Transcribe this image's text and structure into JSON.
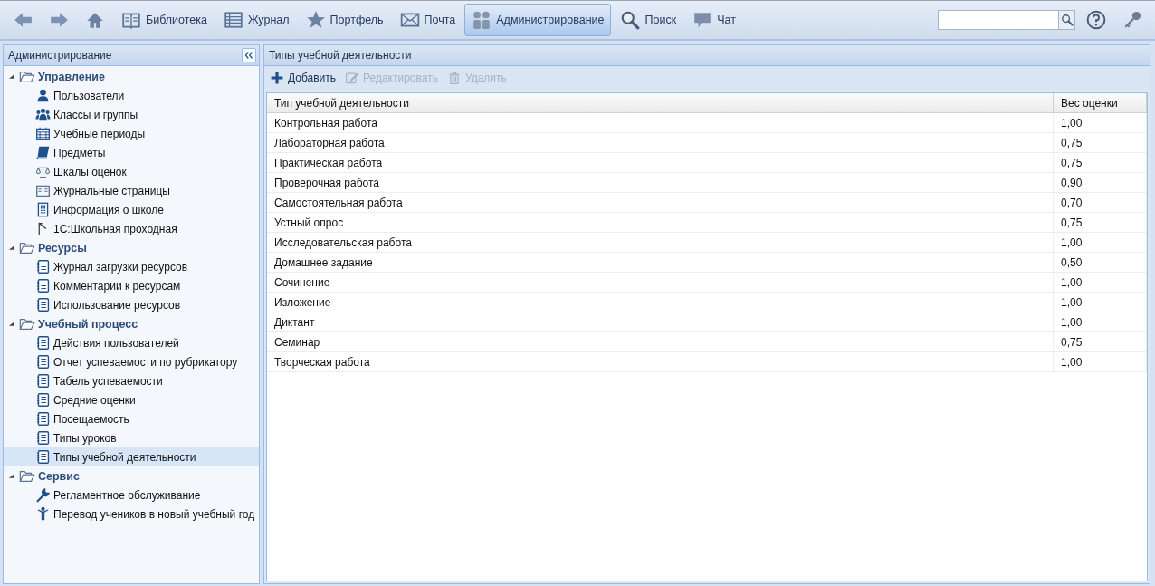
{
  "nav": [
    {
      "kind": "back",
      "selected": false
    },
    {
      "kind": "forward",
      "selected": false
    },
    {
      "kind": "home",
      "selected": false
    },
    {
      "kind": "library",
      "label": "Библиотека",
      "selected": false
    },
    {
      "kind": "journal",
      "label": "Журнал",
      "selected": false
    },
    {
      "kind": "star",
      "label": "Портфель",
      "selected": false
    },
    {
      "kind": "mail",
      "label": "Почта",
      "selected": false
    },
    {
      "kind": "admin",
      "label": "Администрирование",
      "selected": true
    },
    {
      "kind": "search",
      "label": "Поиск",
      "selected": false
    },
    {
      "kind": "chat",
      "label": "Чат",
      "selected": false
    }
  ],
  "sidebar": {
    "title": "Администрирование",
    "groups": [
      {
        "label": "Управление",
        "expanded": true,
        "children": [
          {
            "kind": "user",
            "label": "Пользователи",
            "selected": false
          },
          {
            "kind": "users",
            "label": "Классы и группы",
            "selected": false
          },
          {
            "kind": "calendar",
            "label": "Учебные периоды",
            "selected": false
          },
          {
            "kind": "book",
            "label": "Предметы",
            "selected": false
          },
          {
            "kind": "scales",
            "label": "Шкалы оценок",
            "selected": false
          },
          {
            "kind": "openbook",
            "label": "Журнальные страницы",
            "selected": false
          },
          {
            "kind": "building",
            "label": "Информация о школе",
            "selected": false
          },
          {
            "kind": "flag",
            "label": "1С:Школьная проходная",
            "selected": false
          }
        ]
      },
      {
        "label": "Ресурсы",
        "expanded": true,
        "children": [
          {
            "kind": "report",
            "label": "Журнал загрузки ресурсов",
            "selected": false
          },
          {
            "kind": "report",
            "label": "Комментарии к ресурсам",
            "selected": false
          },
          {
            "kind": "report",
            "label": "Использование ресурсов",
            "selected": false
          }
        ]
      },
      {
        "label": "Учебный процесс",
        "expanded": true,
        "children": [
          {
            "kind": "report",
            "label": "Действия пользователей",
            "selected": false
          },
          {
            "kind": "report",
            "label": "Отчет успеваемости по рубрикатору",
            "selected": false
          },
          {
            "kind": "report",
            "label": "Табель успеваемости",
            "selected": false
          },
          {
            "kind": "report",
            "label": "Средние оценки",
            "selected": false
          },
          {
            "kind": "report",
            "label": "Посещаемость",
            "selected": false
          },
          {
            "kind": "report",
            "label": "Типы уроков",
            "selected": false
          },
          {
            "kind": "report",
            "label": "Типы учебной деятельности",
            "selected": true
          }
        ]
      },
      {
        "label": "Сервис",
        "expanded": true,
        "children": [
          {
            "kind": "wrench",
            "label": "Регламентное обслуживание",
            "selected": false
          },
          {
            "kind": "person",
            "label": "Перевод учеников в новый учебный год",
            "selected": false
          }
        ]
      }
    ]
  },
  "panel": {
    "title": "Типы учебной деятельности",
    "actions": [
      {
        "kind": "add",
        "label": "Добавить",
        "disabled": false
      },
      {
        "kind": "edit",
        "label": "Редактировать",
        "disabled": true
      },
      {
        "kind": "delete",
        "label": "Удалить",
        "disabled": true
      }
    ],
    "table": {
      "columns": [
        "Тип учебной деятельности",
        "Вес оценки"
      ],
      "rows": [
        [
          "Контрольная работа",
          "1,00"
        ],
        [
          "Лабораторная работа",
          "0,75"
        ],
        [
          "Практическая работа",
          "0,75"
        ],
        [
          "Проверочная работа",
          "0,90"
        ],
        [
          "Самостоятельная работа",
          "0,70"
        ],
        [
          "Устный опрос",
          "0,75"
        ],
        [
          "Исследовательская работа",
          "1,00"
        ],
        [
          "Домашнее задание",
          "0,50"
        ],
        [
          "Сочинение",
          "1,00"
        ],
        [
          "Изложение",
          "1,00"
        ],
        [
          "Диктант",
          "1,00"
        ],
        [
          "Семинар",
          "0,75"
        ],
        [
          "Творческая работа",
          "1,00"
        ]
      ]
    }
  }
}
